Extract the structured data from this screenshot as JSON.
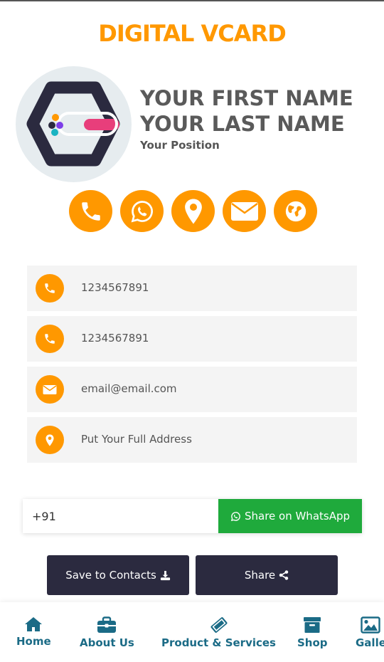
{
  "header": {
    "title": "DIGITAL VCARD"
  },
  "profile": {
    "first_name": "YOUR FIRST NAME",
    "last_name": "YOUR LAST NAME",
    "position": "Your Position"
  },
  "quick_actions": [
    {
      "icon": "phone-icon"
    },
    {
      "icon": "whatsapp-icon"
    },
    {
      "icon": "map-pin-icon"
    },
    {
      "icon": "envelope-icon"
    },
    {
      "icon": "globe-icon"
    }
  ],
  "contact_info": {
    "phone1": "1234567891",
    "phone2": "1234567891",
    "email": "email@email.com",
    "address": "Put Your Full Address"
  },
  "whatsapp_share": {
    "input_value": "+91",
    "button_label": "Share on WhatsApp"
  },
  "actions": {
    "save_label": "Save to Contacts",
    "share_label": "Share"
  },
  "bottom_nav": [
    {
      "label": "Home",
      "icon": "home-icon"
    },
    {
      "label": "About Us",
      "icon": "briefcase-icon"
    },
    {
      "label": "Product & Services",
      "icon": "ticket-icon"
    },
    {
      "label": "Shop",
      "icon": "archive-box-icon"
    },
    {
      "label": "Galle",
      "icon": "image-icon"
    }
  ],
  "colors": {
    "accent": "#ff9800",
    "dark": "#2b2a3f",
    "whatsapp": "#1faa3c",
    "nav_text": "#1b6b86"
  }
}
